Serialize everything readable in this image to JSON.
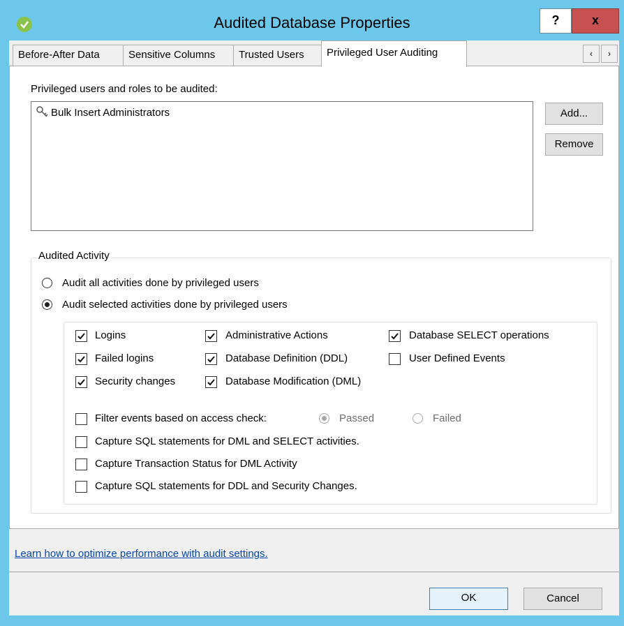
{
  "window": {
    "title": "Audited Database Properties",
    "help_label": "?",
    "close_label": "x"
  },
  "tabs": [
    {
      "label": "Before-After Data"
    },
    {
      "label": "Sensitive Columns"
    },
    {
      "label": "Trusted Users"
    },
    {
      "label": "Privileged User Auditing"
    }
  ],
  "tab_scroll": {
    "left": "‹",
    "right": "›"
  },
  "privileged": {
    "label": "Privileged users and roles to be audited:",
    "items": [
      "Bulk Insert Administrators"
    ],
    "add_label": "Add...",
    "remove_label": "Remove"
  },
  "audited_activity": {
    "legend": "Audited Activity",
    "radio_all": "Audit all activities done by privileged users",
    "radio_selected": "Audit selected activities done by privileged users",
    "selected_mode": "selected",
    "checks": [
      {
        "label": "Logins",
        "checked": true
      },
      {
        "label": "Administrative Actions",
        "checked": true
      },
      {
        "label": "Database SELECT operations",
        "checked": true
      },
      {
        "label": "Failed logins",
        "checked": true
      },
      {
        "label": "Database Definition (DDL)",
        "checked": true
      },
      {
        "label": "User Defined Events",
        "checked": false
      },
      {
        "label": "Security changes",
        "checked": true
      },
      {
        "label": "Database Modification (DML)",
        "checked": true
      }
    ],
    "filter_label": "Filter events based on access check:",
    "filter_checked": false,
    "passed_label": "Passed",
    "failed_label": "Failed",
    "capture_dml_select": "Capture SQL statements for DML and SELECT activities.",
    "capture_transaction": "Capture Transaction Status for DML Activity",
    "capture_ddl_security": "Capture SQL statements for DDL and Security Changes."
  },
  "footer": {
    "link": "Learn how to optimize performance with audit settings.",
    "ok_label": "OK",
    "cancel_label": "Cancel"
  },
  "colors": {
    "titlebar": "#6cc7ea",
    "close": "#c75050",
    "link": "#0645ad"
  }
}
